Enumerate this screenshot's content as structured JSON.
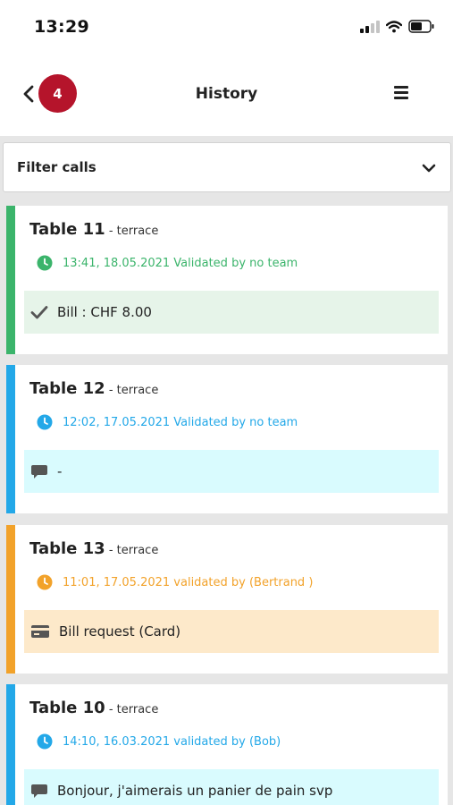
{
  "status_bar": {
    "time": "13:29"
  },
  "header": {
    "badge_count": "4",
    "title": "History"
  },
  "filter": {
    "label": "Filter calls"
  },
  "colors": {
    "green": "#3bb46b",
    "blue": "#23a8e8",
    "orange": "#f2a22a",
    "badge": "#b5142b"
  },
  "cards": [
    {
      "table": "Table 11",
      "area": "terrace",
      "meta": "13:41, 18.05.2021 Validated by no team",
      "message": "Bill : CHF 8.00",
      "icon": "checkmark-icon",
      "color": "green"
    },
    {
      "table": "Table 12",
      "area": "terrace",
      "meta": "12:02, 17.05.2021 Validated by no team",
      "message": "-",
      "icon": "comment-icon",
      "color": "blue"
    },
    {
      "table": "Table 13",
      "area": "terrace",
      "meta": "11:01, 17.05.2021 validated by  (Bertrand )",
      "message": "Bill request (Card)",
      "icon": "credit-card-icon",
      "color": "orange"
    },
    {
      "table": "Table 10",
      "area": "terrace",
      "meta": "14:10, 16.03.2021 validated by  (Bob)",
      "message": "Bonjour, j'aimerais un panier de pain svp",
      "icon": "comment-icon",
      "color": "blue"
    }
  ]
}
